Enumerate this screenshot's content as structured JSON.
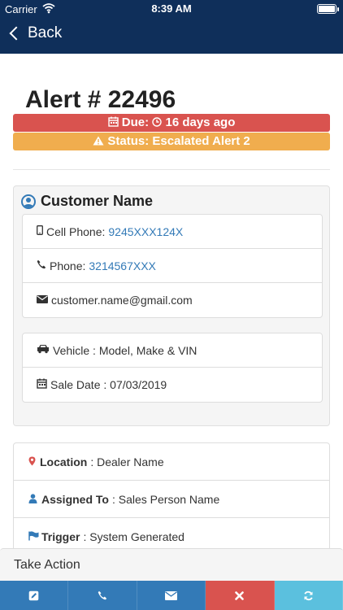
{
  "status_bar": {
    "carrier": "Carrier",
    "time": "8:39 AM"
  },
  "nav": {
    "back_label": "Back"
  },
  "alert": {
    "title": "Alert # 22496",
    "due_label": "Due:",
    "due_value": "16 days ago",
    "status_label": "Status: Escalated Alert 2"
  },
  "customer": {
    "name": "Customer Name",
    "cell_label": "Cell Phone:",
    "cell_value": "9245XXX124X",
    "phone_label": "Phone:",
    "phone_value": "3214567XXX",
    "email": "customer.name@gmail.com"
  },
  "vehicle": {
    "vehicle_label": "Vehicle : Model, Make & VIN",
    "sale_label": "Sale Date : 07/03/2019"
  },
  "info": {
    "location_label": "Location",
    "location_value": ": Dealer Name",
    "assigned_label": "Assigned To",
    "assigned_value": ": Sales Person Name",
    "trigger_label": "Trigger",
    "trigger_value": ": System Generated"
  },
  "actions": {
    "title": "Take Action"
  },
  "colors": {
    "navbar": "#0f2f5a",
    "danger": "#d9534f",
    "warning": "#f0ad4e",
    "primary": "#337ab7",
    "info": "#5bc0de"
  }
}
